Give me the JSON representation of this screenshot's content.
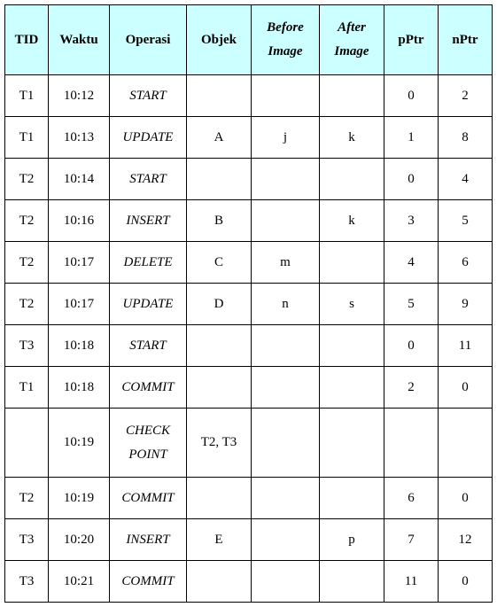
{
  "headers": {
    "tid": "TID",
    "waktu": "Waktu",
    "operasi": "Operasi",
    "objek": "Objek",
    "before_line1": "Before",
    "before_line2": "Image",
    "after_line1": "After",
    "after_line2": "Image",
    "pptr": "pPtr",
    "nptr": "nPtr"
  },
  "rows": [
    {
      "tid": "T1",
      "waktu": "10:12",
      "operasi": "START",
      "objek": "",
      "before": "",
      "after": "",
      "pptr": "0",
      "nptr": "2"
    },
    {
      "tid": "T1",
      "waktu": "10:13",
      "operasi": "UPDATE",
      "objek": "A",
      "before": "j",
      "after": "k",
      "pptr": "1",
      "nptr": "8"
    },
    {
      "tid": "T2",
      "waktu": "10:14",
      "operasi": "START",
      "objek": "",
      "before": "",
      "after": "",
      "pptr": "0",
      "nptr": "4"
    },
    {
      "tid": "T2",
      "waktu": "10:16",
      "operasi": "INSERT",
      "objek": "B",
      "before": "",
      "after": "k",
      "pptr": "3",
      "nptr": "5"
    },
    {
      "tid": "T2",
      "waktu": "10:17",
      "operasi": "DELETE",
      "objek": "C",
      "before": "m",
      "after": "",
      "pptr": "4",
      "nptr": "6"
    },
    {
      "tid": "T2",
      "waktu": "10:17",
      "operasi": "UPDATE",
      "objek": "D",
      "before": "n",
      "after": "s",
      "pptr": "5",
      "nptr": "9"
    },
    {
      "tid": "T3",
      "waktu": "10:18",
      "operasi": "START",
      "objek": "",
      "before": "",
      "after": "",
      "pptr": "0",
      "nptr": "11"
    },
    {
      "tid": "T1",
      "waktu": "10:18",
      "operasi": "COMMIT",
      "objek": "",
      "before": "",
      "after": "",
      "pptr": "2",
      "nptr": "0"
    },
    {
      "tid": "",
      "waktu": "10:19",
      "operasi_line1": "CHECK",
      "operasi_line2": "POINT",
      "objek": "T2, T3",
      "before": "",
      "after": "",
      "pptr": "",
      "nptr": ""
    },
    {
      "tid": "T2",
      "waktu": "10:19",
      "operasi": "COMMIT",
      "objek": "",
      "before": "",
      "after": "",
      "pptr": "6",
      "nptr": "0"
    },
    {
      "tid": "T3",
      "waktu": "10:20",
      "operasi": "INSERT",
      "objek": "E",
      "before": "",
      "after": "p",
      "pptr": "7",
      "nptr": "12"
    },
    {
      "tid": "T3",
      "waktu": "10:21",
      "operasi": "COMMIT",
      "objek": "",
      "before": "",
      "after": "",
      "pptr": "11",
      "nptr": "0"
    }
  ]
}
